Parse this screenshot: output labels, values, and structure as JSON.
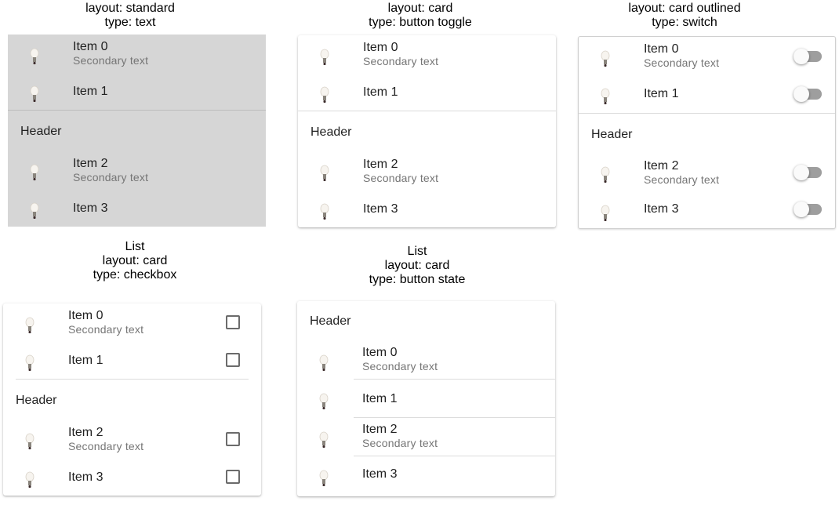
{
  "panels": [
    {
      "caption_lines": [
        "layout: standard",
        "type: text"
      ],
      "header": "Header",
      "items": [
        {
          "primary": "Item 0",
          "secondary": "Secondary text"
        },
        {
          "primary": "Item 1"
        },
        {
          "primary": "Item 2",
          "secondary": "Secondary text"
        },
        {
          "primary": "Item 3"
        }
      ]
    },
    {
      "caption_lines": [
        "layout: card",
        "type: button toggle"
      ],
      "header": "Header",
      "items": [
        {
          "primary": "Item 0",
          "secondary": "Secondary text"
        },
        {
          "primary": "Item 1"
        },
        {
          "primary": "Item 2",
          "secondary": "Secondary text"
        },
        {
          "primary": "Item 3"
        }
      ]
    },
    {
      "caption_lines": [
        "layout: card outlined",
        "type: switch"
      ],
      "header": "Header",
      "items": [
        {
          "primary": "Item 0",
          "secondary": "Secondary text",
          "checked": false
        },
        {
          "primary": "Item 1",
          "checked": false
        },
        {
          "primary": "Item 2",
          "secondary": "Secondary text",
          "checked": false
        },
        {
          "primary": "Item 3",
          "checked": false
        }
      ]
    },
    {
      "caption_lines": [
        "List",
        "layout: card",
        "type: checkbox"
      ],
      "header": "Header",
      "items": [
        {
          "primary": "Item 0",
          "secondary": "Secondary text",
          "checked": false
        },
        {
          "primary": "Item 1",
          "checked": false
        },
        {
          "primary": "Item 2",
          "secondary": "Secondary text",
          "checked": false
        },
        {
          "primary": "Item 3",
          "checked": false
        }
      ]
    },
    {
      "caption_lines": [
        "List",
        "layout: card",
        "type: button state"
      ],
      "header": "Header",
      "items": [
        {
          "primary": "Item 0",
          "secondary": "Secondary text"
        },
        {
          "primary": "Item 1"
        },
        {
          "primary": "Item 2",
          "secondary": "Secondary text"
        },
        {
          "primary": "Item 3"
        }
      ]
    }
  ],
  "icons": {
    "item_icon": "lightbulb-icon"
  }
}
